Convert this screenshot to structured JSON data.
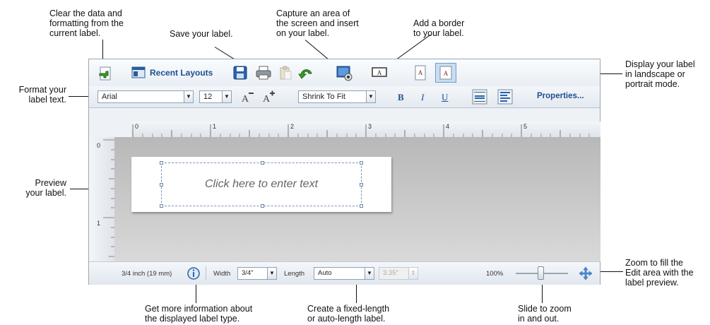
{
  "callouts": {
    "clear": [
      "Clear the data and",
      "formatting from the",
      "current label."
    ],
    "save": "Save your label.",
    "capture": [
      "Capture an area of",
      "the screen and insert",
      "on your label."
    ],
    "border": [
      "Add a border",
      "to your label."
    ],
    "orientation": [
      "Display your label",
      "in landscape or",
      "portrait mode."
    ],
    "format": [
      "Format your",
      "label text."
    ],
    "preview": [
      "Preview",
      "your label."
    ],
    "zoomfill": [
      "Zoom to fill the",
      "Edit area with the",
      "label preview."
    ],
    "info": [
      "Get more information about",
      "the displayed label type."
    ],
    "length": [
      "Create a fixed-length",
      "or auto-length label."
    ],
    "slide": [
      "Slide to zoom",
      "in and out."
    ]
  },
  "toolbar": {
    "recent_layouts": "Recent Layouts",
    "font": "Arial",
    "size": "12",
    "fit": "Shrink To Fit",
    "bold": "B",
    "italic": "I",
    "underline": "U",
    "properties": "Properties..."
  },
  "ruler": {
    "top": [
      "0",
      "1",
      "2",
      "3",
      "4",
      "5"
    ],
    "left": [
      "0",
      "1"
    ]
  },
  "canvas": {
    "placeholder": "Click here to enter text"
  },
  "status": {
    "label_type": "3/4 inch (19 mm)",
    "width_label": "Width",
    "width_value": "3/4\"",
    "length_label": "Length",
    "length_value": "Auto",
    "length_measure": "3.35\"",
    "zoom": "100%"
  },
  "colors": {
    "accent": "#1e4f8f",
    "selected_orientation": "#c9ddf3"
  }
}
